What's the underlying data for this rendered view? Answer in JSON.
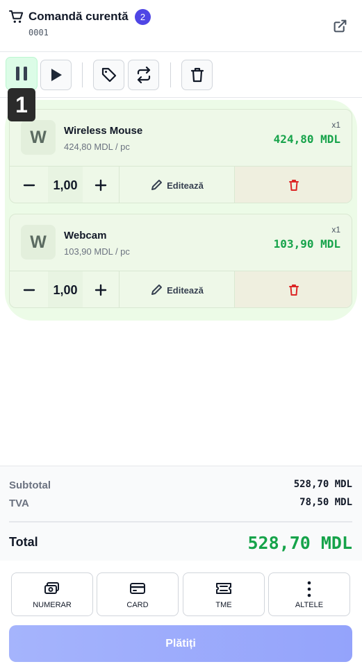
{
  "header": {
    "title": "Comandă curentă",
    "badge_count": "2",
    "order_number": "0001",
    "icons": {
      "cart": "cart-icon",
      "open_external": "external-link-icon"
    }
  },
  "toolbar": {
    "buttons": [
      "pause",
      "play",
      "tag",
      "repeat",
      "trash"
    ],
    "step_number": "1"
  },
  "items": [
    {
      "avatar": "W",
      "name": "Wireless Mouse",
      "unit_price": "424,80 MDL / pc",
      "qty_label": "x1",
      "total": "424,80 MDL",
      "quantity": "1,00",
      "edit_label": "Editează"
    },
    {
      "avatar": "W",
      "name": "Webcam",
      "unit_price": "103,90 MDL / pc",
      "qty_label": "x1",
      "total": "103,90 MDL",
      "quantity": "1,00",
      "edit_label": "Editează"
    }
  ],
  "totals": {
    "subtotal_label": "Subtotal",
    "subtotal": "528,70 MDL",
    "vat_label": "TVA",
    "vat": "78,50 MDL",
    "total_label": "Total",
    "total": "528,70 MDL"
  },
  "payment": {
    "methods": [
      {
        "label": "NUMERAR",
        "icon": "cash-icon"
      },
      {
        "label": "CARD",
        "icon": "card-icon"
      },
      {
        "label": "TME",
        "icon": "ticket-icon"
      },
      {
        "label": "ALTELE",
        "icon": "more-vertical-icon"
      }
    ],
    "pay_label": "Plătiți"
  },
  "colors": {
    "accent": "#4f46e5",
    "price_green": "#16a34a",
    "delete_red": "#dc2626"
  }
}
